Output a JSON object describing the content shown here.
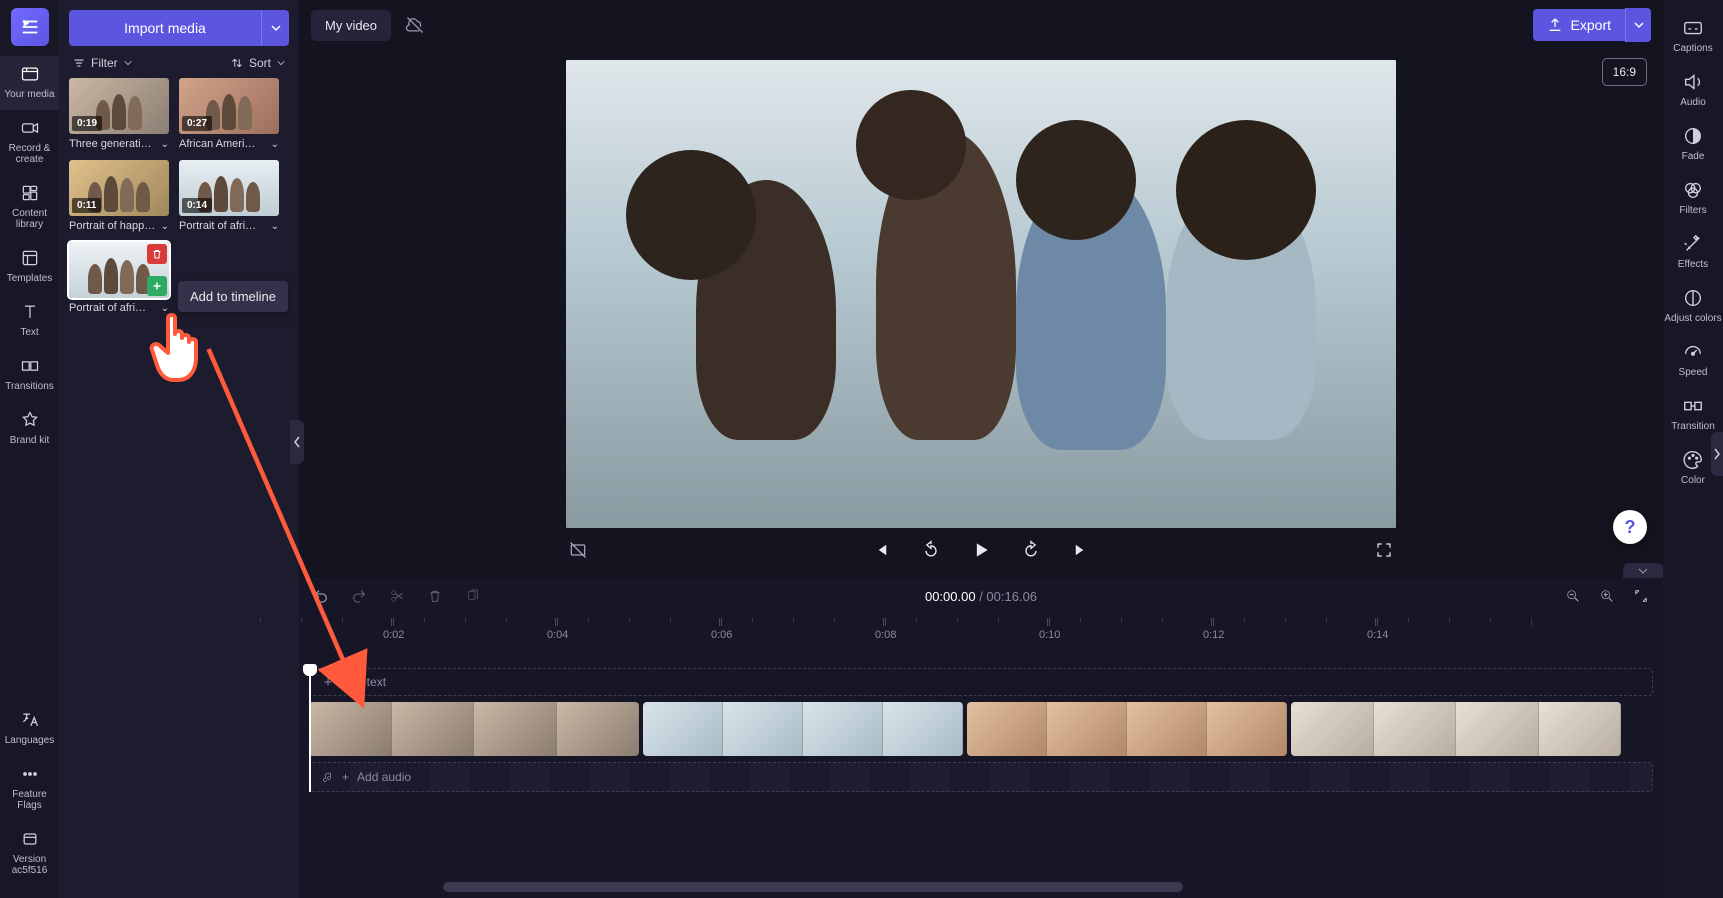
{
  "app": {
    "title": "Clipchamp"
  },
  "leftnav": {
    "items": [
      {
        "label": "Your media"
      },
      {
        "label": "Record & create"
      },
      {
        "label": "Content library"
      },
      {
        "label": "Templates"
      },
      {
        "label": "Text"
      },
      {
        "label": "Transitions"
      },
      {
        "label": "Brand kit"
      }
    ],
    "bottom": [
      {
        "label": "Languages"
      },
      {
        "label": "Feature Flags"
      },
      {
        "label": "Version ac5f516"
      }
    ]
  },
  "rightnav": {
    "items": [
      {
        "label": "Captions"
      },
      {
        "label": "Audio"
      },
      {
        "label": "Fade"
      },
      {
        "label": "Filters"
      },
      {
        "label": "Effects"
      },
      {
        "label": "Adjust colors"
      },
      {
        "label": "Speed"
      },
      {
        "label": "Transition"
      },
      {
        "label": "Color"
      }
    ]
  },
  "mediapanel": {
    "import_label": "Import media",
    "filter_label": "Filter",
    "sort_label": "Sort",
    "clips": [
      {
        "dur": "0:19",
        "name": "Three generati…"
      },
      {
        "dur": "0:27",
        "name": "African Ameri…"
      },
      {
        "dur": "0:11",
        "name": "Portrait of happy…"
      },
      {
        "dur": "0:14",
        "name": "Portrait of afri…"
      },
      {
        "dur": "",
        "name": "Portrait of afri…"
      }
    ],
    "tooltip": "Add to timeline"
  },
  "header": {
    "video_title": "My video",
    "export_label": "Export",
    "aspect": "16:9"
  },
  "playback": {
    "current": "00:00.00",
    "total": "00:16.06"
  },
  "ruler": {
    "ticks": [
      "0:02",
      "0:04",
      "0:06",
      "0:08",
      "0:10",
      "0:12",
      "0:14"
    ]
  },
  "tracks": {
    "add_text": "Add text",
    "add_audio": "Add audio"
  },
  "help": "?"
}
